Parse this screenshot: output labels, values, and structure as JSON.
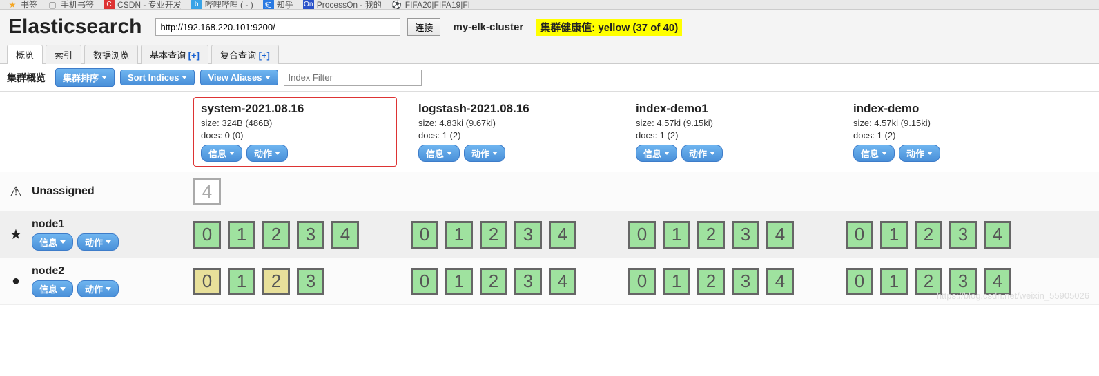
{
  "bookmarks": [
    {
      "icon": "★",
      "icon_color": "#f5a623",
      "label": "书签"
    },
    {
      "icon": "▢",
      "icon_color": "#888",
      "label": "手机书签"
    },
    {
      "icon": "C",
      "icon_bg": "#d33",
      "label": "CSDN - 专业开发"
    },
    {
      "icon": "b",
      "icon_bg": "#3aa3e6",
      "label": "哔哩哔哩 (   -   )"
    },
    {
      "icon": "知",
      "icon_bg": "#2a7ae2",
      "label": "知乎"
    },
    {
      "icon": "On",
      "icon_bg": "#2a52c9",
      "label": "ProcessOn - 我的"
    },
    {
      "icon": "⚽",
      "icon_color": "#333",
      "label": "FIFA20|FIFA19|FI"
    }
  ],
  "header": {
    "logo": "Elasticsearch",
    "url": "http://192.168.220.101:9200/",
    "connect": "连接",
    "cluster_name": "my-elk-cluster",
    "health": "集群健康值: yellow (37 of 40)"
  },
  "tabs": [
    {
      "label": "概览",
      "active": true
    },
    {
      "label": "索引"
    },
    {
      "label": "数据浏览"
    },
    {
      "label": "基本查询",
      "plus": "[+]"
    },
    {
      "label": "复合查询",
      "plus": "[+]"
    }
  ],
  "toolbar": {
    "title": "集群概览",
    "sort_cluster": "集群排序",
    "sort_indices": "Sort Indices",
    "view_aliases": "View Aliases",
    "filter_placeholder": "Index Filter"
  },
  "index_labels": {
    "info": "信息",
    "action": "动作"
  },
  "indices": [
    {
      "name": "system-2021.08.16",
      "size": "size: 324B (486B)",
      "docs": "docs: 0 (0)",
      "selected": true
    },
    {
      "name": "logstash-2021.08.16",
      "size": "size: 4.83ki (9.67ki)",
      "docs": "docs: 1 (2)"
    },
    {
      "name": "index-demo1",
      "size": "size: 4.57ki (9.15ki)",
      "docs": "docs: 1 (2)"
    },
    {
      "name": "index-demo",
      "size": "size: 4.57ki (9.15ki)",
      "docs": "docs: 1 (2)"
    }
  ],
  "node_labels": {
    "info": "信息",
    "action": "动作"
  },
  "rows": [
    {
      "icon": "⚠",
      "name": "Unassigned",
      "no_buttons": true,
      "shards": [
        [
          {
            "n": "4",
            "cls": "unassigned"
          }
        ],
        [],
        [],
        []
      ]
    },
    {
      "icon": "★",
      "name": "node1",
      "shards": [
        [
          {
            "n": "0"
          },
          {
            "n": "1"
          },
          {
            "n": "2"
          },
          {
            "n": "3"
          },
          {
            "n": "4"
          }
        ],
        [
          {
            "n": "0"
          },
          {
            "n": "1"
          },
          {
            "n": "2"
          },
          {
            "n": "3"
          },
          {
            "n": "4"
          }
        ],
        [
          {
            "n": "0"
          },
          {
            "n": "1"
          },
          {
            "n": "2"
          },
          {
            "n": "3"
          },
          {
            "n": "4"
          }
        ],
        [
          {
            "n": "0"
          },
          {
            "n": "1"
          },
          {
            "n": "2"
          },
          {
            "n": "3"
          },
          {
            "n": "4"
          }
        ]
      ]
    },
    {
      "icon": "●",
      "name": "node2",
      "shards": [
        [
          {
            "n": "0",
            "cls": "reloc"
          },
          {
            "n": "1"
          },
          {
            "n": "2",
            "cls": "reloc"
          },
          {
            "n": "3"
          }
        ],
        [
          {
            "n": "0"
          },
          {
            "n": "1"
          },
          {
            "n": "2"
          },
          {
            "n": "3"
          },
          {
            "n": "4"
          }
        ],
        [
          {
            "n": "0"
          },
          {
            "n": "1"
          },
          {
            "n": "2"
          },
          {
            "n": "3"
          },
          {
            "n": "4"
          }
        ],
        [
          {
            "n": "0"
          },
          {
            "n": "1"
          },
          {
            "n": "2"
          },
          {
            "n": "3"
          },
          {
            "n": "4"
          }
        ]
      ]
    }
  ],
  "watermark": "https://blog.csdn.net/weixin_55905026"
}
